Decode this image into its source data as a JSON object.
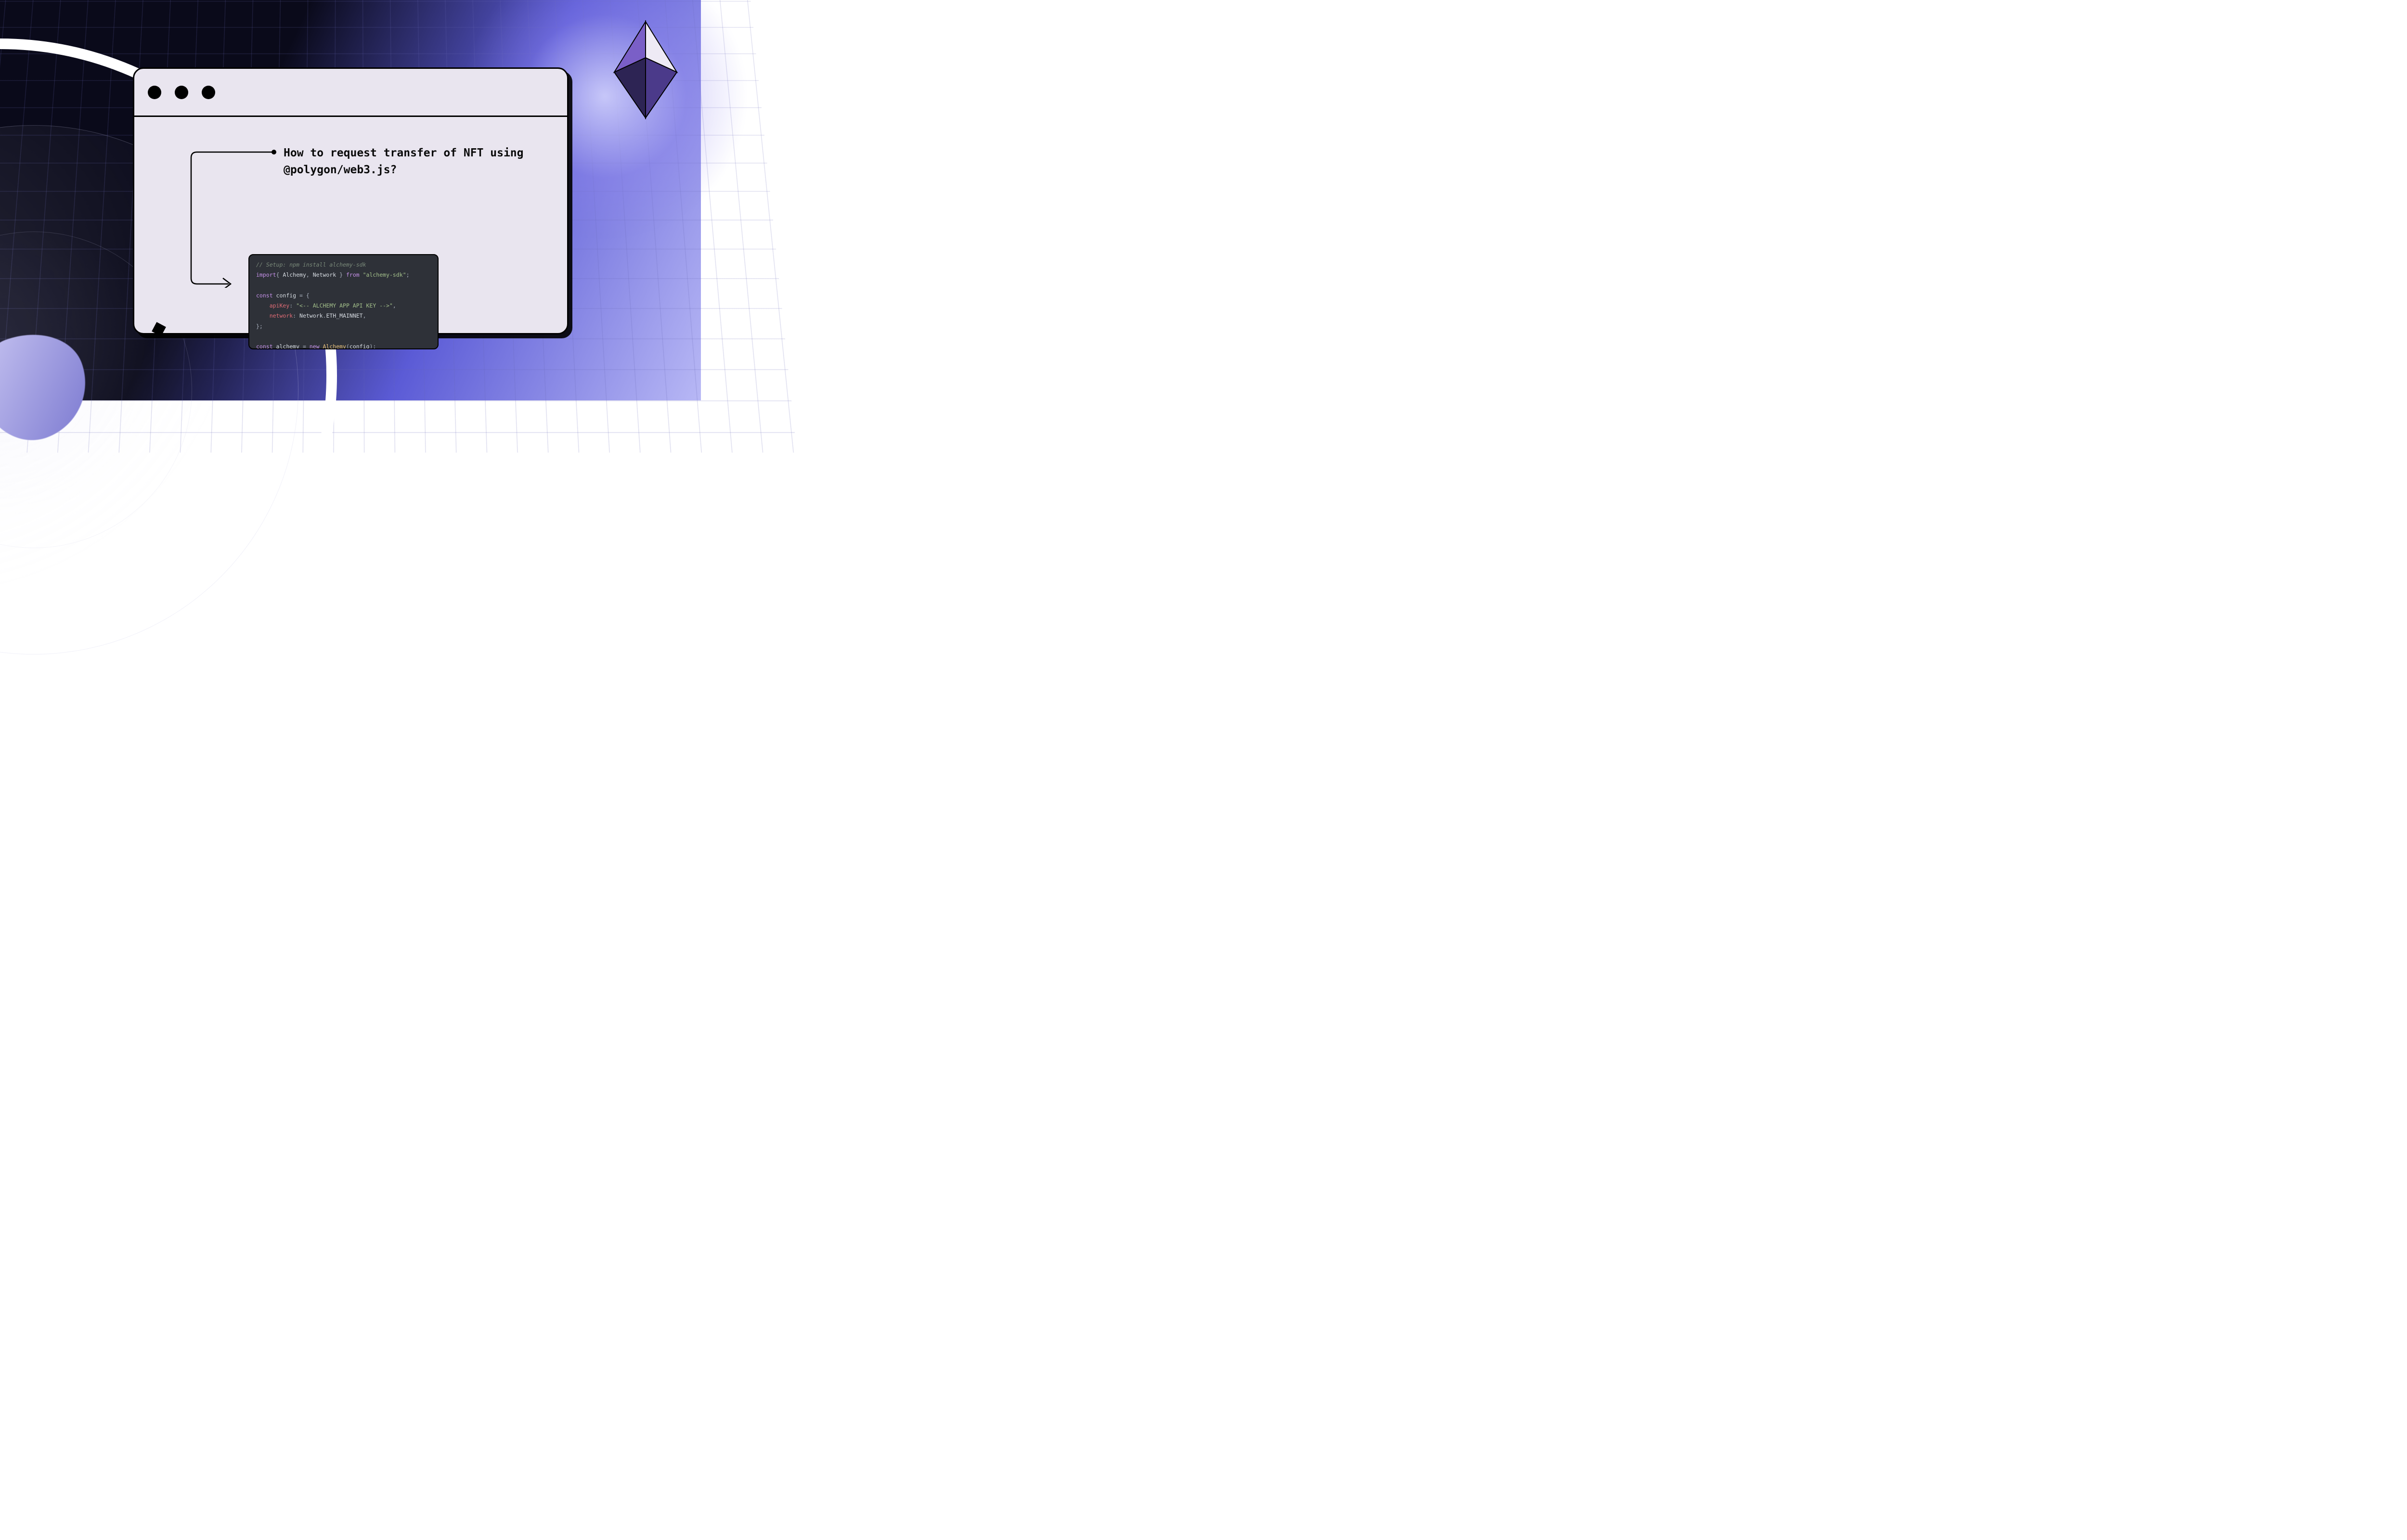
{
  "heading": "How to request transfer of NFT using @polygon/web3.js?",
  "code": {
    "comment": "// Setup: npm install alchemy-sdk",
    "import_kw": "import",
    "import_braces_open": "{ ",
    "import_1": "Alchemy",
    "import_sep": ", ",
    "import_2": "Network",
    "import_braces_close": " }",
    "from_kw": " from ",
    "import_module": "\"alchemy-sdk\"",
    "semi": ";",
    "const_kw": "const",
    "config_name": " config ",
    "eq": "= ",
    "brace_open": "{",
    "apiKey_prop": "apiKey",
    "colon": ": ",
    "apiKey_val": "\"<-- ALCHEMY APP API KEY -->\"",
    "comma": ",",
    "network_prop": "network",
    "network_val_a": "Network",
    "dot": ".",
    "network_val_b": "ETH_MAINNET",
    "brace_close": "};",
    "alchemy_name": " alchemy ",
    "new_kw": "new ",
    "alchemy_class": "Alchemy",
    "paren_open": "(",
    "config_ref": "config",
    "paren_close": ");"
  }
}
